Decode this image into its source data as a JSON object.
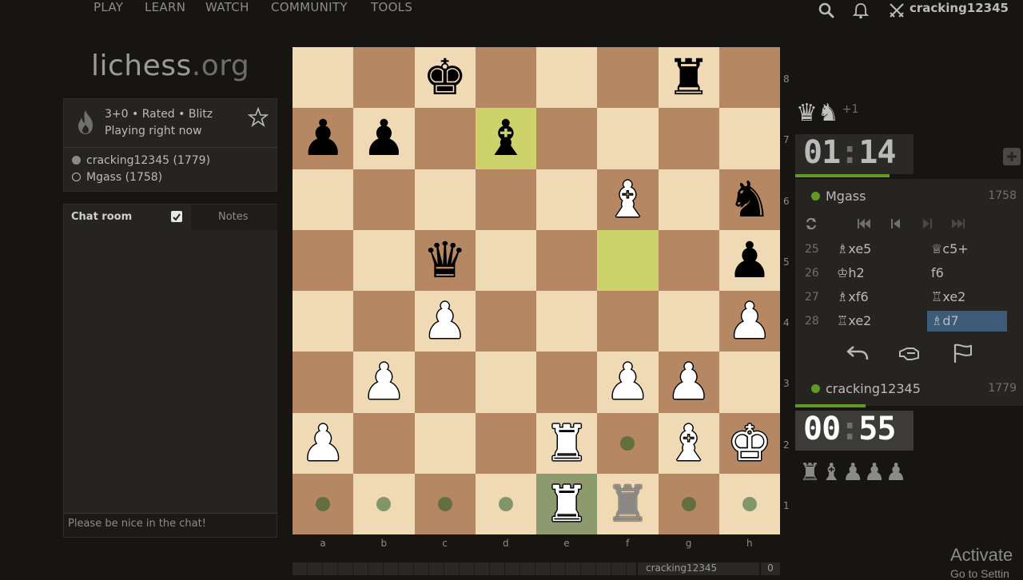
{
  "nav": {
    "items": [
      "PLAY",
      "LEARN",
      "WATCH",
      "COMMUNITY",
      "TOOLS"
    ],
    "username": "cracking12345"
  },
  "logo": {
    "name": "lichess",
    "tld": ".org"
  },
  "game_info": {
    "line1": "3+0 • Rated • Blitz",
    "line2": "Playing right now",
    "players": [
      {
        "label": "cracking12345 (1779)",
        "color": "white"
      },
      {
        "label": "Mgass (1758)",
        "color": "black"
      }
    ]
  },
  "chat": {
    "tab_chat": "Chat room",
    "tab_notes": "Notes",
    "placeholder": "Please be nice in the chat!"
  },
  "board": {
    "files": [
      "a",
      "b",
      "c",
      "d",
      "e",
      "f",
      "g",
      "h"
    ],
    "ranks": [
      "8",
      "7",
      "6",
      "5",
      "4",
      "3",
      "2",
      "1"
    ],
    "pieces": [
      {
        "sq": "c8",
        "p": "k"
      },
      {
        "sq": "g8",
        "p": "r"
      },
      {
        "sq": "a7",
        "p": "p"
      },
      {
        "sq": "b7",
        "p": "p"
      },
      {
        "sq": "d7",
        "p": "b"
      },
      {
        "sq": "f6",
        "p": "B"
      },
      {
        "sq": "h6",
        "p": "n"
      },
      {
        "sq": "c5",
        "p": "q"
      },
      {
        "sq": "h5",
        "p": "p"
      },
      {
        "sq": "c4",
        "p": "P"
      },
      {
        "sq": "h4",
        "p": "P"
      },
      {
        "sq": "b3",
        "p": "P"
      },
      {
        "sq": "f3",
        "p": "P"
      },
      {
        "sq": "g3",
        "p": "P"
      },
      {
        "sq": "a2",
        "p": "P"
      },
      {
        "sq": "e2",
        "p": "R"
      },
      {
        "sq": "g2",
        "p": "B"
      },
      {
        "sq": "h2",
        "p": "K"
      },
      {
        "sq": "e1",
        "p": "R"
      }
    ],
    "ghost": {
      "sq": "f1",
      "p": "R"
    },
    "last_move": [
      "d7",
      "f5"
    ],
    "hover": "e1",
    "move_dots": [
      "a1",
      "b1",
      "c1",
      "d1",
      "g1",
      "h1",
      "f2"
    ]
  },
  "opponent": {
    "name": "Mgass",
    "rating": "1758",
    "clock_min": "01",
    "clock_sec": "14",
    "captured": "♛♞",
    "advantage": "+1"
  },
  "player": {
    "name": "cracking12345",
    "rating": "1779",
    "clock_min": "00",
    "clock_sec": "55",
    "captured": "♜♝♟♟♟"
  },
  "moves": [
    {
      "n": "25",
      "w": "♗xe5",
      "b": "♕c5+"
    },
    {
      "n": "26",
      "w": "♔h2",
      "b": "f6"
    },
    {
      "n": "27",
      "w": "♗xf6",
      "b": "♖xe2"
    },
    {
      "n": "28",
      "w": "♖xe2",
      "b": "♗d7"
    }
  ],
  "overlay": {
    "activate": "Activate",
    "activate_sub": "Go to Settin",
    "bottom_name": "cracking12345",
    "bottom_num": "0"
  }
}
